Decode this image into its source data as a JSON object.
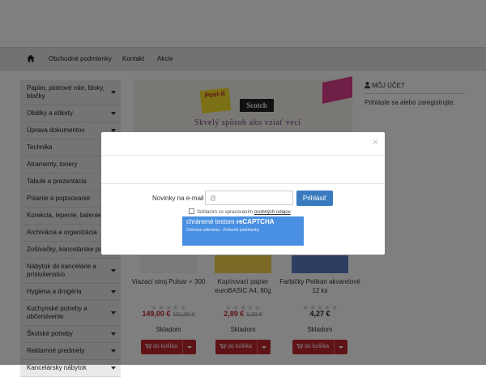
{
  "nav": {
    "home_icon": "home-icon",
    "items": [
      "Obchodné podmienky",
      "Kontakt",
      "Akcie"
    ]
  },
  "sidebar": {
    "categories": [
      {
        "label": "Papier, plotrové role, bloky, bločky",
        "dropdown": true
      },
      {
        "label": "Obálky a etikety",
        "dropdown": true
      },
      {
        "label": "Úprava dokumentov",
        "dropdown": true
      },
      {
        "label": "Technika",
        "dropdown": false
      },
      {
        "label": "Atramenty, tonery",
        "dropdown": false
      },
      {
        "label": "Tabule a prezentácia",
        "dropdown": false
      },
      {
        "label": "Písanie a popisovanie",
        "dropdown": false
      },
      {
        "label": "Korekcia, lepenie, balenie",
        "dropdown": false
      },
      {
        "label": "Archivácia a organizácia",
        "dropdown": false
      },
      {
        "label": "Zošívačky, kancelárske pot",
        "dropdown": true
      },
      {
        "label": "Nábytok do kancelárie a príslušenstvo",
        "dropdown": true
      },
      {
        "label": "Hygiena a drogéria",
        "dropdown": true
      },
      {
        "label": "Kuchynské potreby a občerstvenie",
        "dropdown": true
      },
      {
        "label": "Školské potreby",
        "dropdown": true
      },
      {
        "label": "Reklamné predmety",
        "dropdown": true
      },
      {
        "label": "Kancelársky nábytok",
        "dropdown": true
      }
    ]
  },
  "banner": {
    "brand1": "Post-it",
    "brand2": "Scotch",
    "slogan": "Skvelý spôsob ako vziať veci"
  },
  "account": {
    "title": "MÔJ ÚČET",
    "text": "Prihláste sa alebo zaregistrujte."
  },
  "products": [
    {
      "name": "Viazací stroj Pulsar + 300",
      "price": "149,00 €",
      "old_price": "181,00 €",
      "stock": "Skladom",
      "cart_label": "do košíka",
      "price_color": "#c0262d"
    },
    {
      "name": "Kopírovací papier euroBASIC A4, 80g",
      "price": "2,89 €",
      "old_price": "5,30 €",
      "stock": "Skladom",
      "cart_label": "do košíka",
      "price_color": "#c0262d"
    },
    {
      "name": "Farbičky Pelikan akvarelové 12 ks",
      "price": "4,27 €",
      "old_price": "",
      "stock": "Skladom",
      "cart_label": "do košíka",
      "price_color": "#222222"
    }
  ],
  "modal": {
    "close": "×",
    "newsletter_label": "Novinky na e-mail",
    "email_placeholder": "@",
    "submit_label": "Prihlásiť",
    "consent_text": "Súhlasím so spracovaním",
    "consent_link": "osobných údajov",
    "recaptcha_line1": "chránené testom",
    "recaptcha_brand": "reCAPTCHA",
    "recaptcha_line2": "Ochrana súkromia - Zmluvné podmienky"
  },
  "colors": {
    "accent_red": "#c0262d",
    "accent_blue": "#3a7bbf",
    "recaptcha_blue": "#4a90e2"
  }
}
